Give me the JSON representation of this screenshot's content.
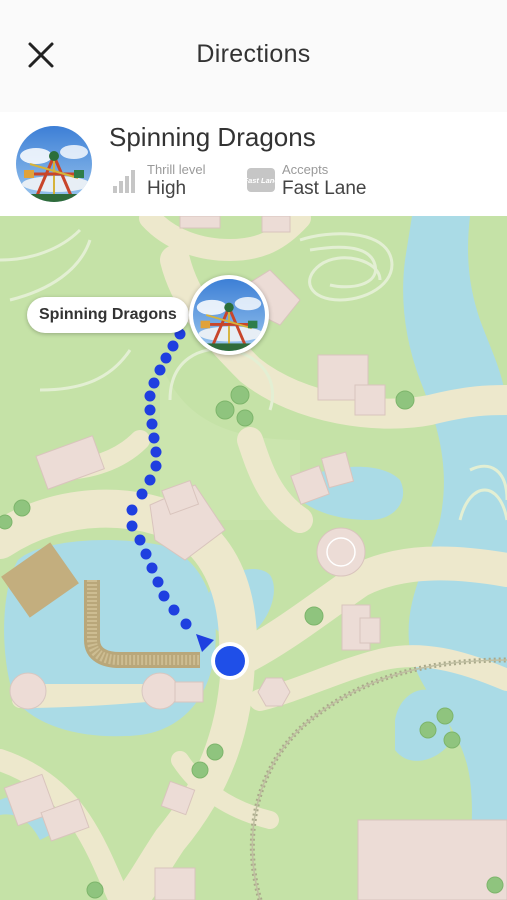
{
  "header": {
    "title": "Directions",
    "close_icon": "close-icon"
  },
  "ride": {
    "name": "Spinning Dragons",
    "thrill_label": "Thrill level",
    "thrill_value": "High",
    "thrill_icon": "signal-bars-icon",
    "accepts_label": "Accepts",
    "accepts_value": "Fast Lane",
    "fastlane_icon": "fast-lane-icon",
    "fastlane_icon_text": "Fast Lane"
  },
  "map": {
    "destination_label": "Spinning Dragons",
    "route_color": "#1f3fe0",
    "location_color": "#1f4fe8",
    "grass_color": "#c5e2a7",
    "water_color": "#aadbe6",
    "path_color": "#ede8cc",
    "building_color": "#ecdcd6"
  }
}
